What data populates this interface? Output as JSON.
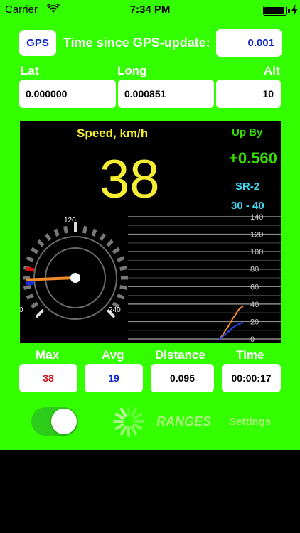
{
  "status_bar": {
    "carrier": "Carrier",
    "time": "7:34 PM",
    "battery_level": 0.95
  },
  "gps": {
    "button_label": "GPS",
    "time_label": "Time since GPS-update:",
    "time_value": "0.001"
  },
  "coords": {
    "lat_label": "Lat",
    "lat_value": "0.000000",
    "long_label": "Long",
    "long_value": "0.000851",
    "alt_label": "Alt",
    "alt_value": "10"
  },
  "speed_panel": {
    "title": "Speed, km/h",
    "value": "38",
    "upby_label": "Up By",
    "upby_value": "+0.560",
    "sr_name": "SR-2",
    "sr_range": "30 - 40",
    "gauge": {
      "ticks": [
        "0",
        "120",
        "240"
      ],
      "needle_speed": 38,
      "max_speed": 240
    }
  },
  "chart_data": {
    "type": "line",
    "title": "",
    "xlabel": "",
    "ylabel": "",
    "ylim": [
      0,
      140
    ],
    "y_ticks": [
      0,
      20,
      40,
      60,
      80,
      100,
      120,
      140
    ],
    "grid": true,
    "series": [
      {
        "values": [
          0,
          2,
          5,
          9,
          12,
          16,
          20,
          24,
          27,
          31,
          34,
          36,
          38
        ],
        "color": "#f08a2a"
      },
      {
        "values": [
          0,
          1,
          3,
          5,
          7,
          9,
          11,
          13,
          15,
          16,
          17,
          18,
          19
        ],
        "color": "#2244ee"
      }
    ]
  },
  "stats": {
    "max_label": "Max",
    "max_value": "38",
    "avg_label": "Avg",
    "avg_value": "19",
    "distance_label": "Distance",
    "distance_value": "0.095",
    "time_label": "Time",
    "time_value": "00:00:17"
  },
  "controls": {
    "toggle_on": true,
    "ranges_label": "RANGES",
    "settings_label": "Settings"
  },
  "colors": {
    "background": "#33FF00",
    "speed": "#f5ee32",
    "upby": "#33dd00",
    "sr": "#3fd8f0",
    "max": "#d0141c",
    "avg": "#1025c8"
  }
}
